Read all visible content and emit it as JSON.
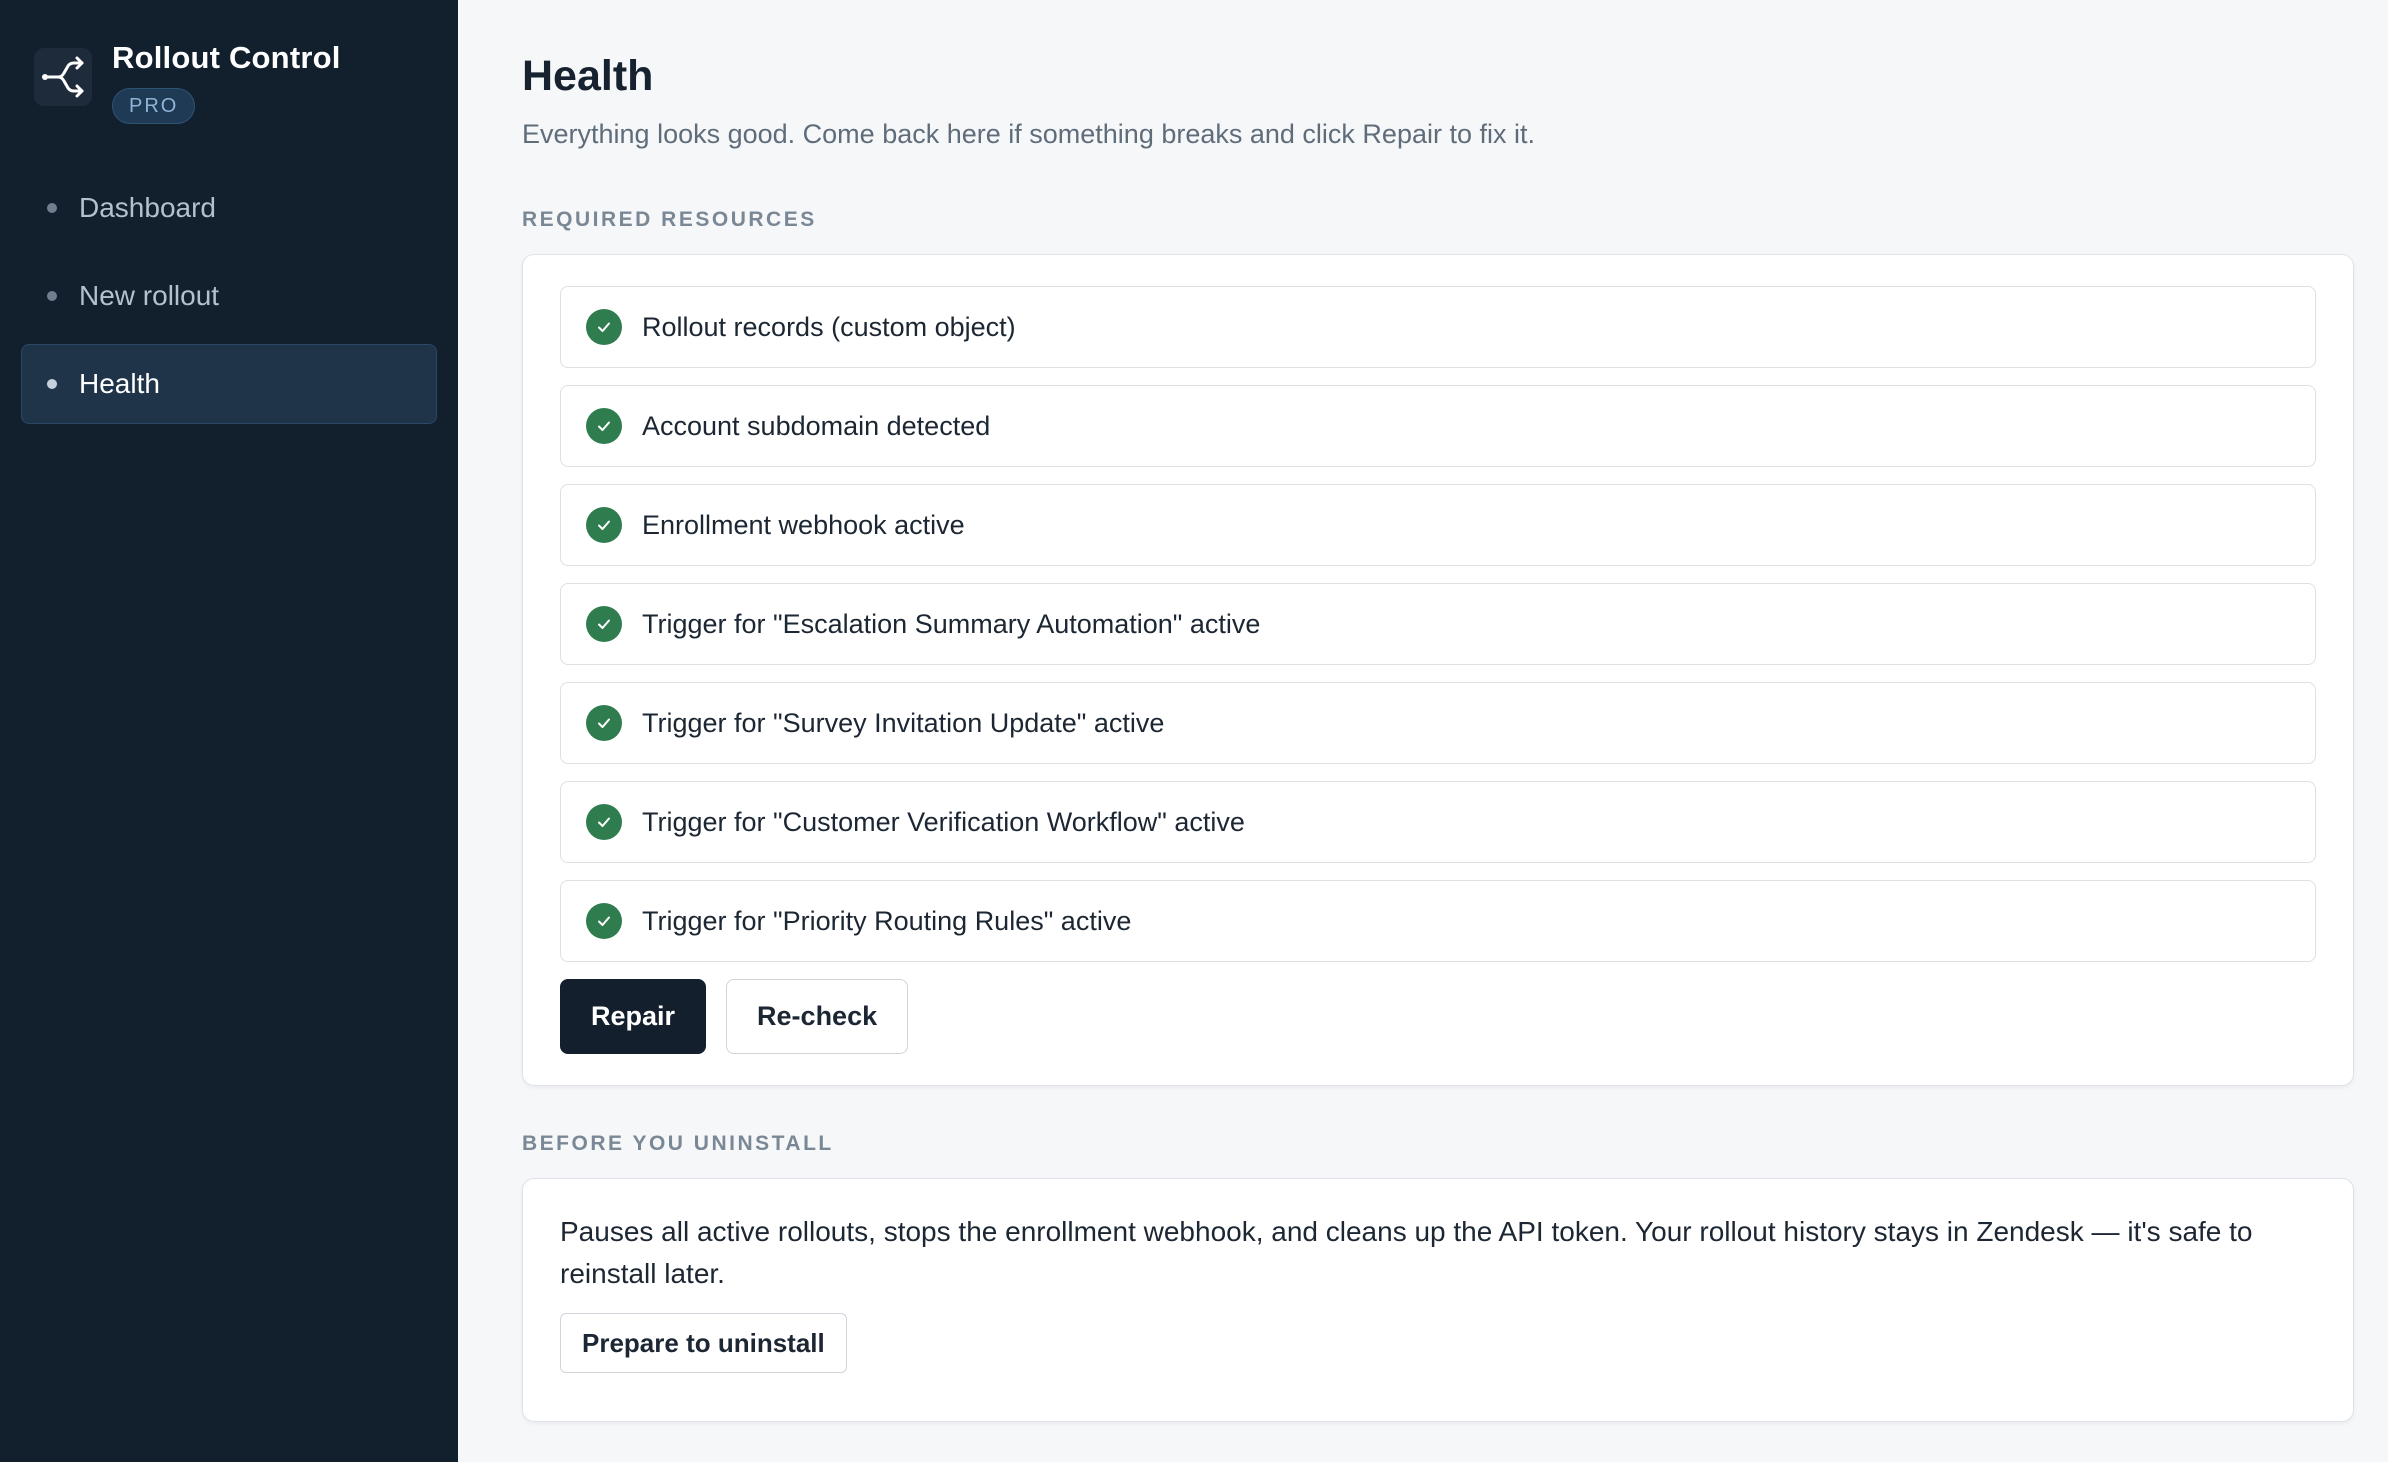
{
  "app": {
    "title": "Rollout Control",
    "badge": "PRO",
    "logo_icon": "branch-arrows-icon"
  },
  "sidebar": {
    "items": [
      {
        "label": "Dashboard",
        "active": false
      },
      {
        "label": "New rollout",
        "active": false
      },
      {
        "label": "Health",
        "active": true
      }
    ]
  },
  "main": {
    "title": "Health",
    "subtitle": "Everything looks good. Come back here if something breaks and click Repair to fix it.",
    "resources_label": "REQUIRED RESOURCES",
    "resources": [
      {
        "label": "Rollout records (custom object)",
        "status": "ok"
      },
      {
        "label": "Account subdomain detected",
        "status": "ok"
      },
      {
        "label": "Enrollment webhook active",
        "status": "ok"
      },
      {
        "label": "Trigger for \"Escalation Summary Automation\" active",
        "status": "ok"
      },
      {
        "label": "Trigger for \"Survey Invitation Update\" active",
        "status": "ok"
      },
      {
        "label": "Trigger for \"Customer Verification Workflow\" active",
        "status": "ok"
      },
      {
        "label": "Trigger for \"Priority Routing Rules\" active",
        "status": "ok"
      }
    ],
    "repair_label": "Repair",
    "recheck_label": "Re-check",
    "uninstall_label": "BEFORE YOU UNINSTALL",
    "uninstall_text": "Pauses all active rollouts, stops the enrollment webhook, and cleans up the API token. Your rollout history stays in Zendesk — it's safe to reinstall later.",
    "uninstall_button": "Prepare to uninstall"
  },
  "colors": {
    "sidebar_bg": "#12202e",
    "success": "#2f7d4f",
    "primary_button": "#131f2c"
  }
}
